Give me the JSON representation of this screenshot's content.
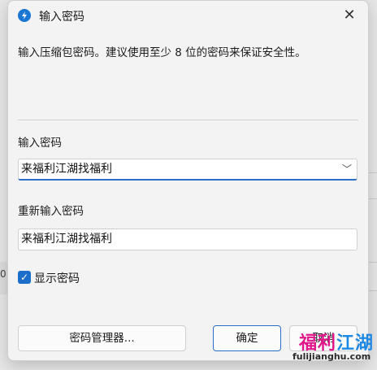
{
  "dialog": {
    "title": "输入密码",
    "close_icon": "close-icon",
    "app_icon": "app-logo-icon",
    "description": "输入压缩包密码。建议使用至少 8 位的密码来保证安全性。",
    "password_label": "输入密码",
    "password_value": "来福利江湖找福利",
    "confirm_label": "重新输入密码",
    "confirm_value": "来福利江湖找福利",
    "show_password_label": "显示密码",
    "show_password_checked": true,
    "password_manager_button": "密码管理器...",
    "ok_button": "确定",
    "cancel_button": "取消"
  },
  "background": {
    "left_text": "0"
  },
  "watermark": {
    "main_a": "福利",
    "main_b": "江湖",
    "sub": "fulijianghu.com"
  },
  "colors": {
    "accent": "#1b6ec9",
    "watermark_pink": "#e0168a",
    "watermark_blue": "#1e88e5"
  }
}
